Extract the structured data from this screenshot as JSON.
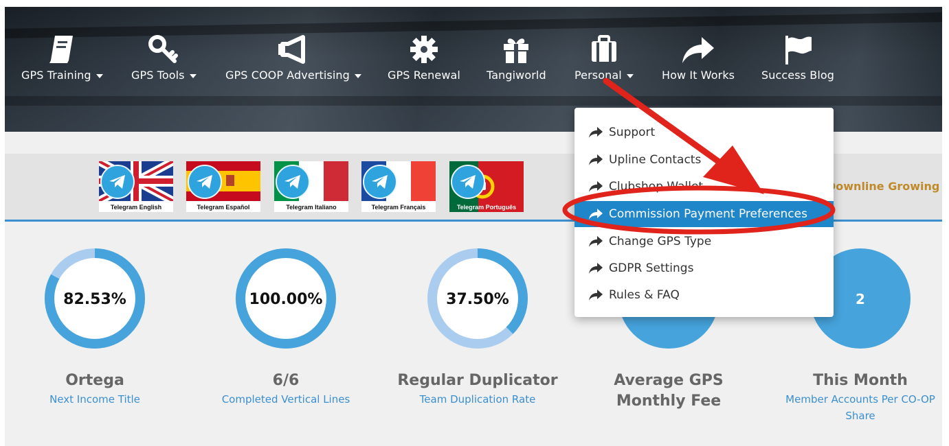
{
  "nav": {
    "items": [
      {
        "label": "GPS Training",
        "icon": "book-icon",
        "has_caret": true
      },
      {
        "label": "GPS Tools",
        "icon": "key-icon",
        "has_caret": true
      },
      {
        "label": "GPS COOP Advertising",
        "icon": "megaphone-icon",
        "has_caret": true
      },
      {
        "label": "GPS Renewal",
        "icon": "gear-icon",
        "has_caret": false
      },
      {
        "label": "Tangiworld",
        "icon": "gift-icon",
        "has_caret": false
      },
      {
        "label": "Personal",
        "icon": "briefcase-icon",
        "has_caret": true
      },
      {
        "label": "How It Works",
        "icon": "share-arrow-icon",
        "has_caret": false
      },
      {
        "label": "Success Blog",
        "icon": "flag-icon",
        "has_caret": false
      }
    ]
  },
  "telegram": {
    "groups": [
      {
        "caption": "Telegram English",
        "flag": "uk"
      },
      {
        "caption": "Telegram Español",
        "flag": "spain"
      },
      {
        "caption": "Telegram Italiano",
        "flag": "italy"
      },
      {
        "caption": "Telegram Français",
        "flag": "france"
      },
      {
        "caption": "Telegram Português",
        "flag": "portugal"
      }
    ],
    "banner_text": "Downline Growing"
  },
  "stats": [
    {
      "value": "82.53%",
      "fill": 0.83,
      "title": "Ortega",
      "subtitle": "Next Income Title",
      "style": "ring"
    },
    {
      "value": "100.00%",
      "fill": 1.0,
      "title": "6/6",
      "subtitle": "Completed Vertical Lines",
      "style": "ring"
    },
    {
      "value": "37.50%",
      "fill": 0.375,
      "title": "Regular Duplicator",
      "subtitle": "Team Duplication Rate",
      "style": "ring"
    },
    {
      "value": "",
      "title": "Average GPS Monthly Fee",
      "subtitle": "",
      "style": "solid"
    },
    {
      "value": "2",
      "title": "This Month",
      "subtitle": "Member Accounts Per CO-OP Share",
      "style": "solid"
    }
  ],
  "personal_menu": {
    "items": [
      {
        "label": "Support",
        "active": false
      },
      {
        "label": "Upline Contacts",
        "active": false
      },
      {
        "label": "Clubshop Wallet",
        "active": false
      },
      {
        "label": "Commission Payment Preferences",
        "active": true
      },
      {
        "label": "Change GPS Type",
        "active": false
      },
      {
        "label": "GDPR Settings",
        "active": false
      },
      {
        "label": "Rules & FAQ",
        "active": false
      }
    ]
  },
  "colors": {
    "accent": "#3a8fd0",
    "ring_track": "#aacdef",
    "ring_fill": "#46a3dc",
    "annotation_red": "#e0231b",
    "menu_active": "#1f86c9",
    "banner_text": "#c08a2b"
  }
}
